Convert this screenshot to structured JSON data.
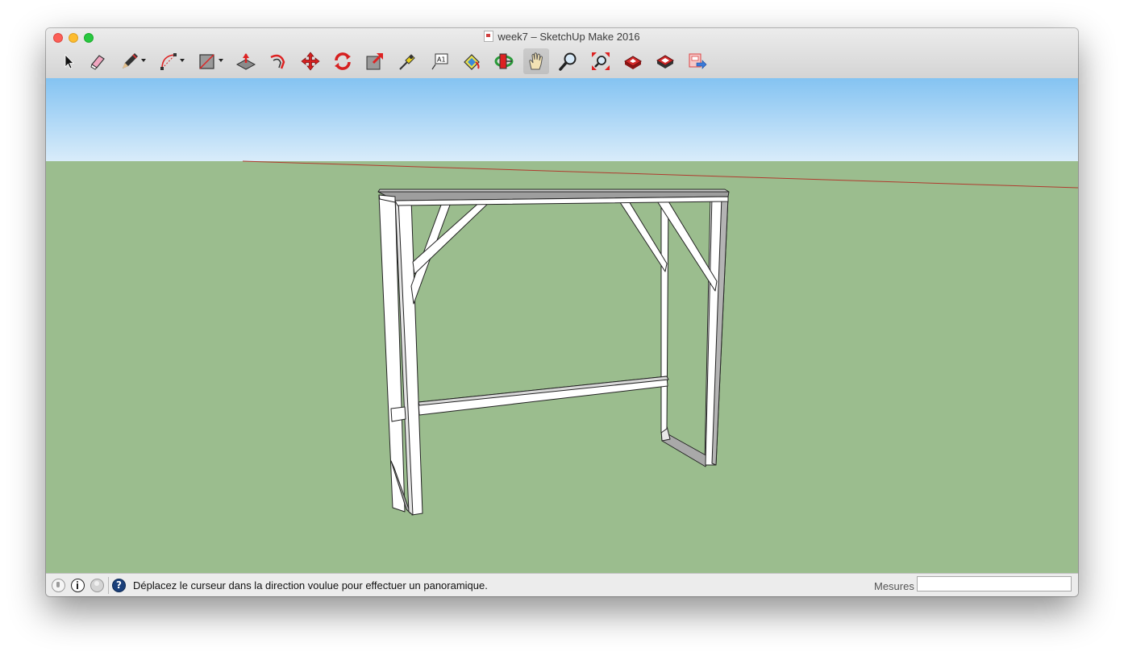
{
  "window": {
    "title": "week7 – SketchUp Make 2016"
  },
  "toolbar": {
    "tools": [
      {
        "name": "select-tool",
        "icon": "arrow-cursor-icon"
      },
      {
        "name": "eraser-tool",
        "icon": "eraser-icon"
      },
      {
        "name": "line-tool",
        "icon": "pencil-icon"
      },
      {
        "name": "arc-tool",
        "icon": "arc-icon"
      },
      {
        "name": "rectangle-tool",
        "icon": "rectangle-icon"
      },
      {
        "name": "push-pull-tool",
        "icon": "push-pull-icon"
      },
      {
        "name": "offset-tool",
        "icon": "offset-icon"
      },
      {
        "name": "move-tool",
        "icon": "move-arrows-icon"
      },
      {
        "name": "rotate-tool",
        "icon": "rotate-icon"
      },
      {
        "name": "scale-tool",
        "icon": "scale-icon"
      },
      {
        "name": "tape-measure-tool",
        "icon": "tape-measure-icon"
      },
      {
        "name": "text-tool",
        "icon": "text-label-icon"
      },
      {
        "name": "paint-bucket-tool",
        "icon": "paint-bucket-icon"
      },
      {
        "name": "orbit-tool",
        "icon": "orbit-icon"
      },
      {
        "name": "pan-tool",
        "icon": "hand-icon"
      },
      {
        "name": "zoom-tool",
        "icon": "magnifier-icon"
      },
      {
        "name": "zoom-extents-tool",
        "icon": "zoom-extents-icon"
      },
      {
        "name": "3d-warehouse-tool",
        "icon": "warehouse-icon"
      },
      {
        "name": "extension-warehouse-tool",
        "icon": "extension-warehouse-icon"
      },
      {
        "name": "send-to-layout-tool",
        "icon": "layout-icon"
      }
    ],
    "label_text": "A1"
  },
  "statusbar": {
    "help_icon_text": "?",
    "message": "Déplacez le curseur dans la direction voulue pour effectuer un panoramique.",
    "measurements_label": "Mesures",
    "measurements_value": ""
  },
  "colors": {
    "sky_top": "#84c3f2",
    "sky_bottom": "#d9ecfa",
    "ground": "#9bbd8e",
    "red_axis": "#b03a2e",
    "model_face": "#ffffff",
    "model_shade": "#aaaaaa",
    "model_edge": "#222222"
  }
}
